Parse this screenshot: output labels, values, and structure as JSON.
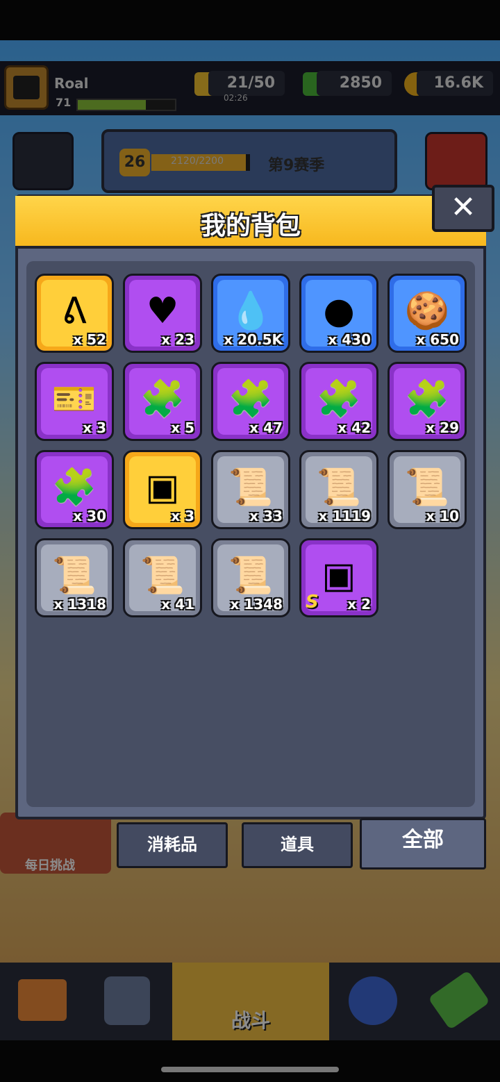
{
  "player": {
    "name": "Roal",
    "level": "71"
  },
  "resources": [
    {
      "icon": "energy-icon",
      "value": "21/50",
      "timer": "02:26"
    },
    {
      "icon": "gem-icon",
      "value": "2850"
    },
    {
      "icon": "coin-icon",
      "value": "16.6K"
    }
  ],
  "season": {
    "rank": "26",
    "progress": "2120/2200",
    "progress_fraction": 0.96,
    "label": "第9赛季"
  },
  "daily_challenge": "每日挑战",
  "modal": {
    "title": "我的背包",
    "close_label": "✕",
    "items": [
      {
        "rarity": "gold",
        "icon": "orange-orb-icon",
        "symbol": "ᕕ",
        "count": "x 52"
      },
      {
        "rarity": "purple",
        "icon": "heart-orb-icon",
        "symbol": "♥",
        "count": "x 23"
      },
      {
        "rarity": "blue",
        "icon": "golden-drop-icon",
        "symbol": "💧",
        "count": "x 20.5K"
      },
      {
        "rarity": "blue",
        "icon": "gold-coin-icon",
        "symbol": "●",
        "count": "x 430"
      },
      {
        "rarity": "blue",
        "icon": "dog-cookie-icon",
        "symbol": "🍪",
        "count": "x 650"
      },
      {
        "rarity": "purple",
        "icon": "gold-ticket-icon",
        "symbol": "🎫",
        "count": "x 3"
      },
      {
        "rarity": "purple",
        "icon": "hero-puzzle-icon",
        "symbol": "🧩",
        "count": "x 5"
      },
      {
        "rarity": "purple",
        "icon": "hero-puzzle-icon",
        "symbol": "🧩",
        "count": "x 47"
      },
      {
        "rarity": "purple",
        "icon": "cat-puzzle-icon",
        "symbol": "🧩",
        "count": "x 42"
      },
      {
        "rarity": "purple",
        "icon": "robot-puzzle-icon",
        "symbol": "🧩",
        "count": "x 29"
      },
      {
        "rarity": "purple",
        "icon": "soldier-puzzle-icon",
        "symbol": "🧩",
        "count": "x 30"
      },
      {
        "rarity": "gold",
        "icon": "treasure-chest-icon",
        "symbol": "▣",
        "count": "x 3"
      },
      {
        "rarity": "grey",
        "icon": "weapon-scroll-icon",
        "symbol": "📜",
        "count": "x 33"
      },
      {
        "rarity": "grey",
        "icon": "armor-scroll-icon",
        "symbol": "📜",
        "count": "x 1119"
      },
      {
        "rarity": "grey",
        "icon": "necklace-scroll-icon",
        "symbol": "📜",
        "count": "x 10"
      },
      {
        "rarity": "grey",
        "icon": "belt-scroll-icon",
        "symbol": "📜",
        "count": "x 1318"
      },
      {
        "rarity": "grey",
        "icon": "glove-scroll-icon",
        "symbol": "📜",
        "count": "x 41"
      },
      {
        "rarity": "grey",
        "icon": "boots-scroll-icon",
        "symbol": "📜",
        "count": "x 1348"
      },
      {
        "rarity": "purple",
        "icon": "s-chest-icon",
        "symbol": "▣",
        "count": "x 2",
        "rank": "S"
      }
    ]
  },
  "tabs": [
    {
      "label": "消耗品"
    },
    {
      "label": "道具"
    },
    {
      "label": "全部"
    }
  ],
  "bottom_nav": {
    "battle_label": "战斗"
  }
}
